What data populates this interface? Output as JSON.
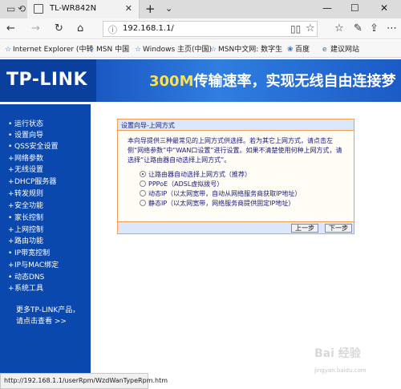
{
  "browser": {
    "tab_title": "TL-WR842N",
    "tab_close": "✕",
    "new_tab": "+",
    "tab_dropdown": "⌄",
    "window_min": "—",
    "window_max": "☐",
    "window_close": "✕",
    "address": "192.168.1.1/",
    "status_url": "http://192.168.1.1/userRpm/WzdWanTypeRpm.htm"
  },
  "favorites": [
    {
      "label": "Internet Explorer (中转"
    },
    {
      "label": "MSN 中国"
    },
    {
      "label": "Windows 主页(中国)"
    },
    {
      "label": "MSN中文网: 数字生"
    },
    {
      "label": "百度"
    },
    {
      "label": "建议网站"
    }
  ],
  "banner": {
    "logo": "TP-LINK",
    "slogan_prefix": "300M",
    "slogan_rest": "传输速率，实现无线自由连接梦"
  },
  "sidebar": {
    "items": [
      {
        "label": "运行状态"
      },
      {
        "label": "设置向导"
      },
      {
        "label": "QSS安全设置"
      },
      {
        "label": "网络参数"
      },
      {
        "label": "无线设置"
      },
      {
        "label": "DHCP服务器"
      },
      {
        "label": "转发规则"
      },
      {
        "label": "安全功能"
      },
      {
        "label": "家长控制"
      },
      {
        "label": "上网控制"
      },
      {
        "label": "路由功能"
      },
      {
        "label": "IP带宽控制"
      },
      {
        "label": "IP与MAC绑定"
      },
      {
        "label": "动态DNS"
      },
      {
        "label": "系统工具"
      }
    ],
    "more_line1": "更多TP-LINK产品，",
    "more_line2": "请点击查看 >>"
  },
  "wizard": {
    "title": "设置向导-上网方式",
    "description": "本向导提供三种最常见的上网方式供选择。若为其它上网方式，请点击左侧“网络参数”中“WAN口设置”进行设置。如果不清楚使用何种上网方式，请选择“让路由器自动选择上网方式”。",
    "options": [
      {
        "label": "让路由器自动选择上网方式（推荐）",
        "selected": true
      },
      {
        "label": "PPPoE（ADSL虚拟拨号）",
        "selected": false
      },
      {
        "label": "动态IP（以太网宽带，自动从网络服务商获取IP地址）",
        "selected": false
      },
      {
        "label": "静态IP（以太网宽带，网络服务商提供固定IP地址）",
        "selected": false
      }
    ],
    "prev_label": "上一步",
    "next_label": "下一步"
  }
}
